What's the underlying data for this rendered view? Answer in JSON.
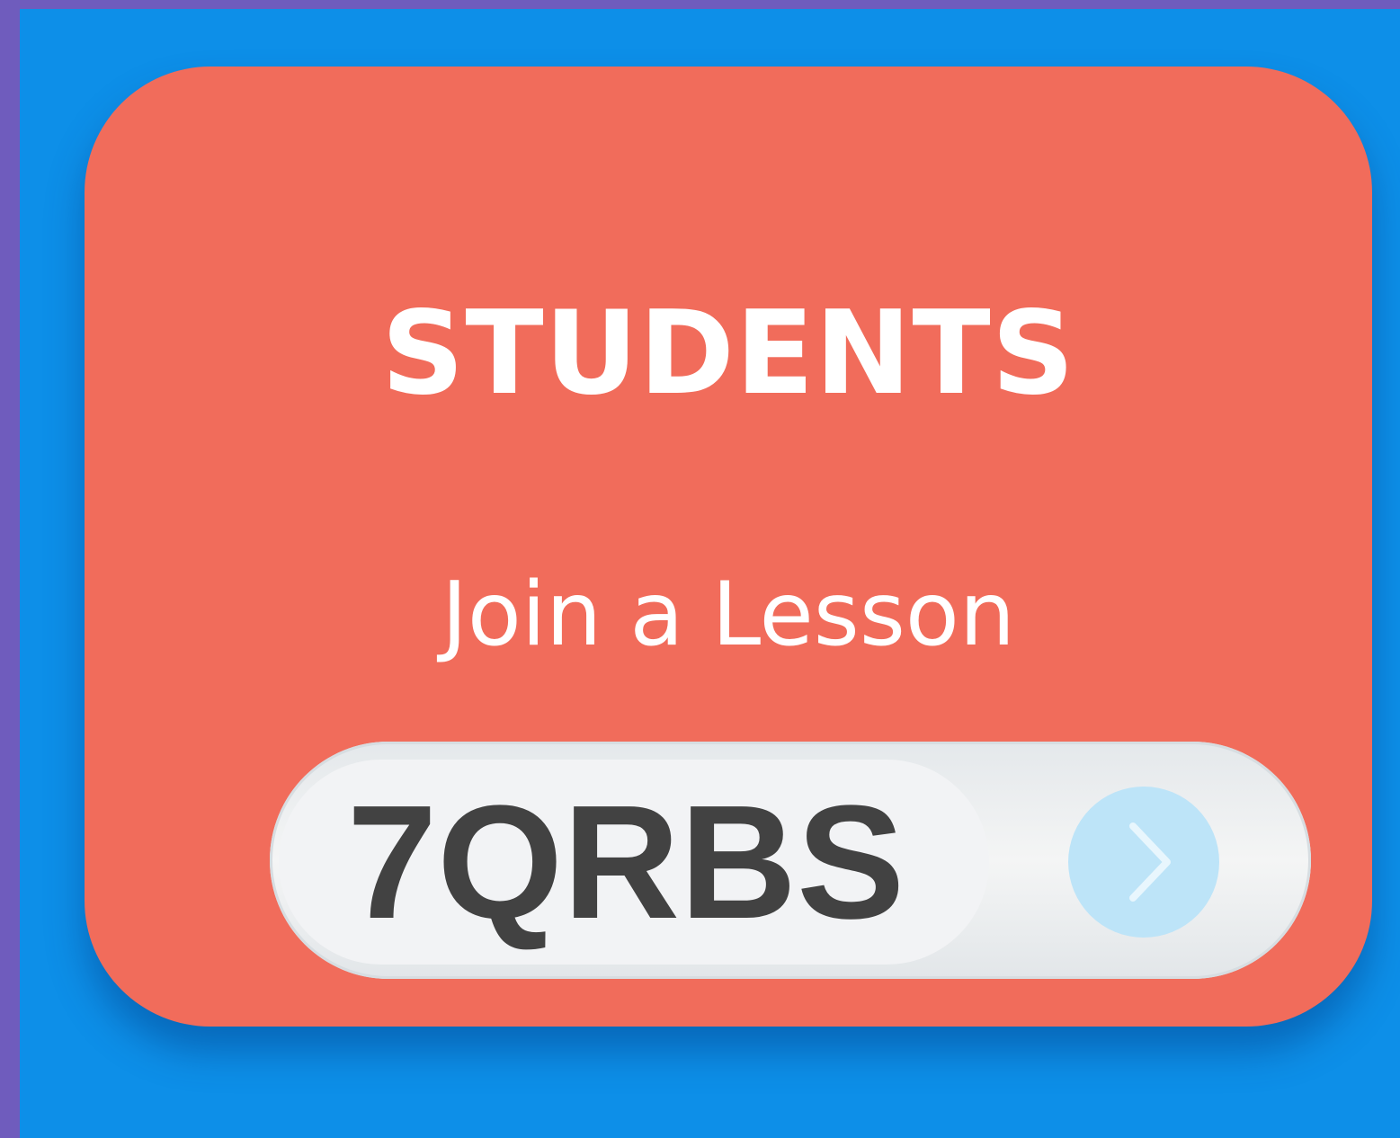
{
  "colors": {
    "frame": "#6f5cbd",
    "background": "#0d8fe8",
    "card": "#f16c5b",
    "code_text": "#424242",
    "go_button": "#bde4f8",
    "go_chevron": "#e8f6fd"
  },
  "card": {
    "heading": "STUDENTS",
    "subheading": "Join a Lesson"
  },
  "join_form": {
    "code_value": "7QRBS",
    "submit_icon": "chevron-right-icon"
  }
}
